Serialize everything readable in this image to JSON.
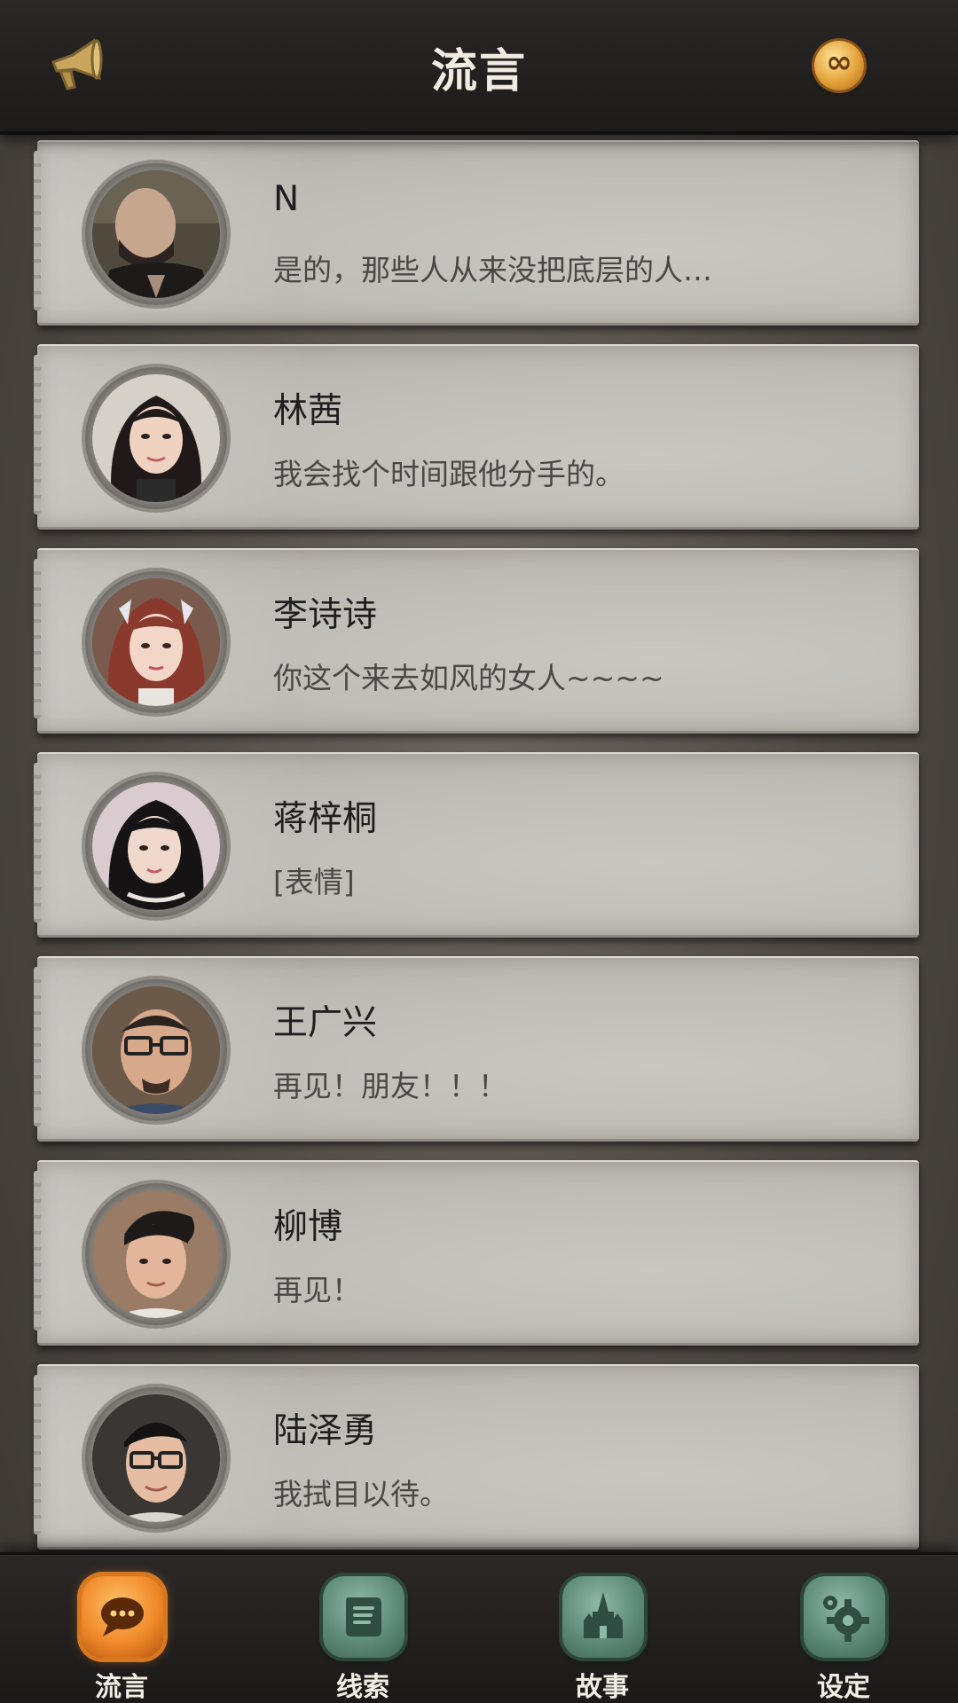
{
  "header": {
    "title": "流言",
    "left_icon": "megaphone-icon",
    "right_icon": "infinity-coin-icon",
    "coin_symbol": "∞"
  },
  "contacts": [
    {
      "name": "N",
      "message": "是的，那些人从来没把底层的人…",
      "avatar": "dark-masked-man"
    },
    {
      "name": "林茜",
      "message": "我会找个时间跟他分手的。",
      "avatar": "young-woman-dark-hair"
    },
    {
      "name": "李诗诗",
      "message": "你这个来去如风的女人~~~~",
      "avatar": "woman-red-hair-headband"
    },
    {
      "name": "蒋梓桐",
      "message": "[表情]",
      "avatar": "woman-black-hair"
    },
    {
      "name": "王广兴",
      "message": "再见！朋友！！！",
      "avatar": "man-glasses-beard"
    },
    {
      "name": "柳博",
      "message": "再见！",
      "avatar": "young-man-styled-hair"
    },
    {
      "name": "陆泽勇",
      "message": "我拭目以待。",
      "avatar": "man-glasses"
    }
  ],
  "tabs": [
    {
      "label": "流言",
      "icon": "chat-bubble-icon",
      "active": true
    },
    {
      "label": "线索",
      "icon": "scroll-icon",
      "active": false
    },
    {
      "label": "故事",
      "icon": "castle-icon",
      "active": false
    },
    {
      "label": "设定",
      "icon": "gear-icon",
      "active": false
    }
  ]
}
